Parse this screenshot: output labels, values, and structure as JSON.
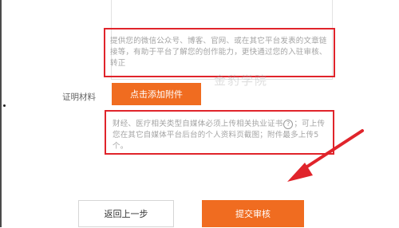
{
  "form": {
    "link_hint": "提供您的微信公众号、博客、官网、或在其它平台发表的文章链接等，有助于平台了解您的创作能力，更快通过您的入驻审核、转正",
    "material_label": "证明材料",
    "attach_button": "点击添加附件",
    "watermark": "金豹学院",
    "material_hint_pre": "财经、医疗相关类型自媒体必须上传相关执业证书",
    "material_hint_icon": "?",
    "material_hint_post": "；可上传您在其它自媒体平台后台的个人资料页截图；附件最多上传5个。"
  },
  "actions": {
    "back_label": "返回上一步",
    "submit_label": "提交审核"
  },
  "colors": {
    "accent": "#f06c20",
    "annotation_red": "#e0242b"
  }
}
